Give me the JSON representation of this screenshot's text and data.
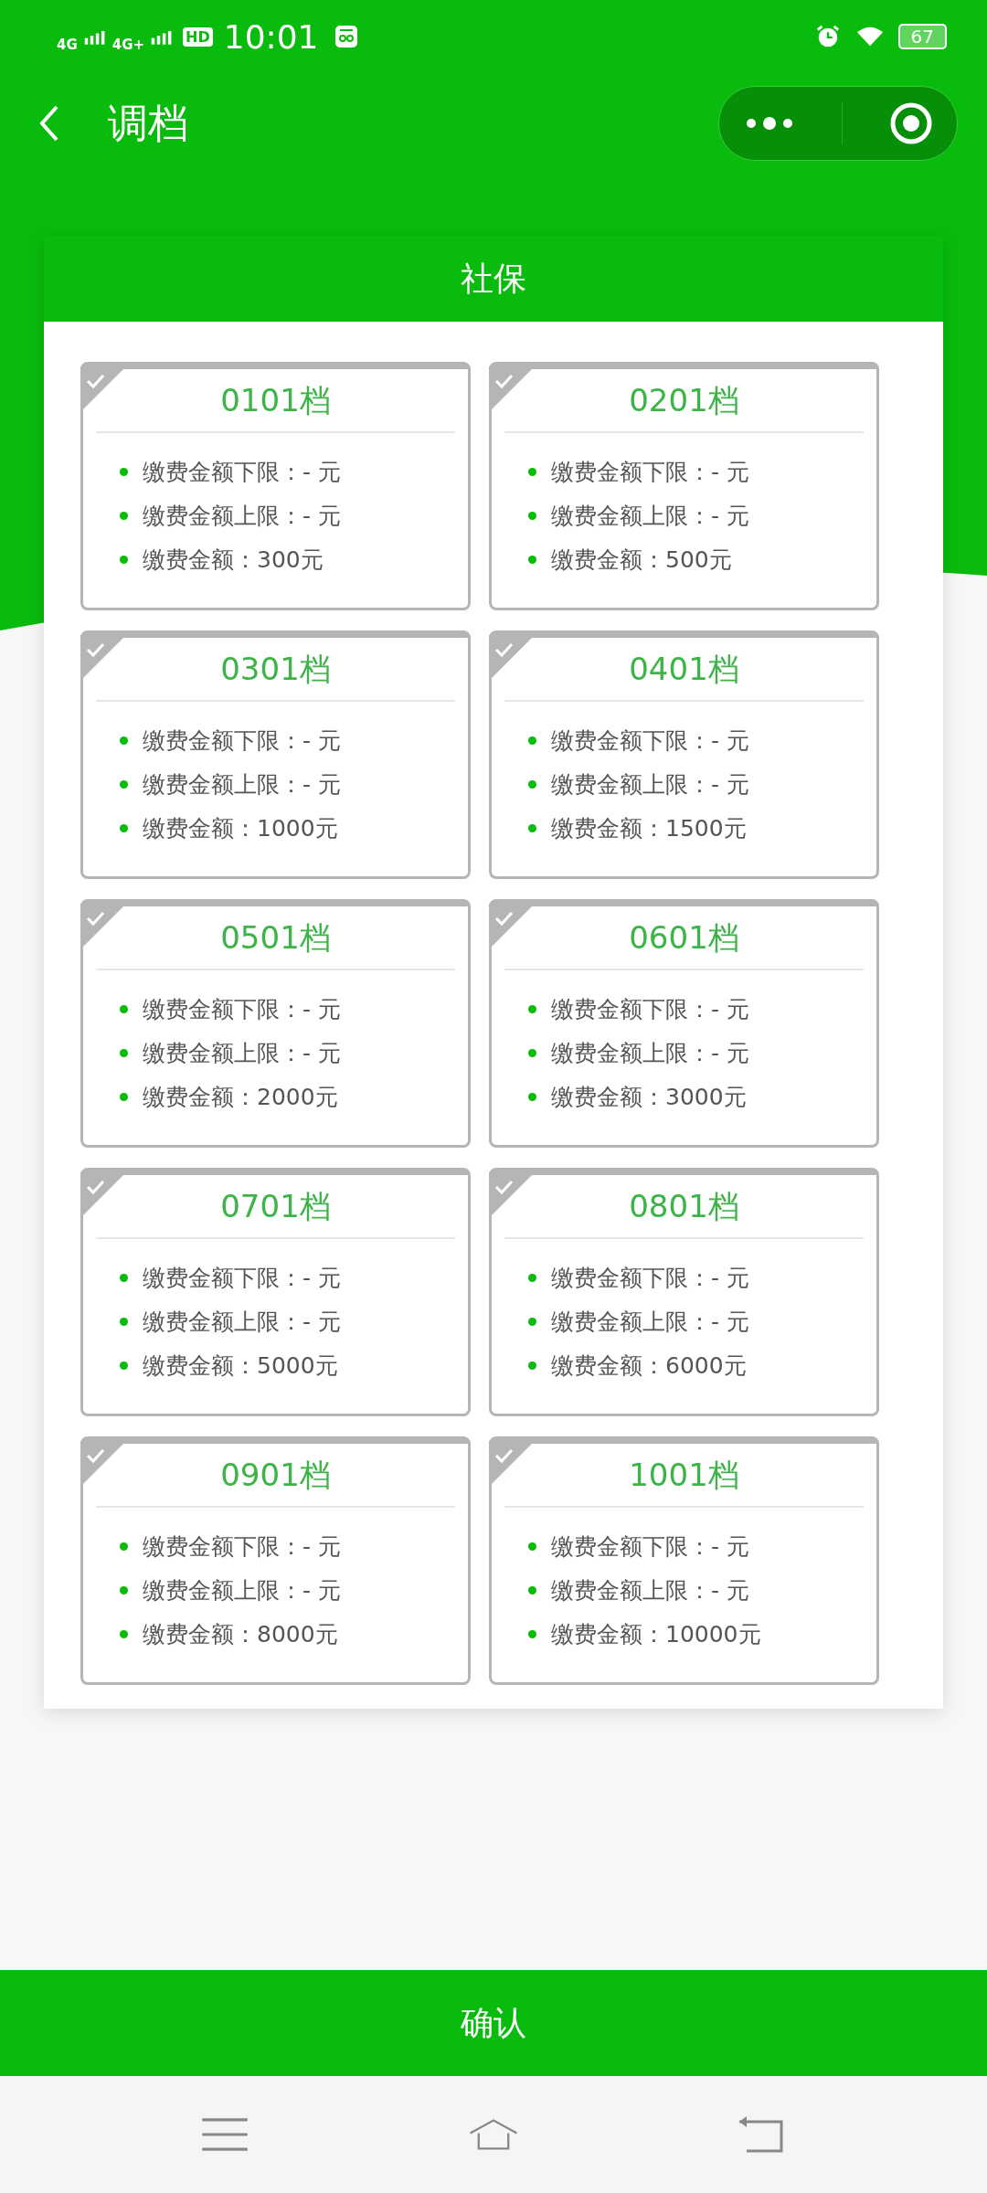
{
  "status_bar": {
    "network_1": "4G",
    "network_2": "4G+",
    "hd": "HD",
    "time": "10:01",
    "battery": "67"
  },
  "header": {
    "title": "调档"
  },
  "panel": {
    "title": "社保",
    "tiers": [
      {
        "name": "0101档",
        "selected": false,
        "lines": [
          "缴费金额下限：- 元",
          "缴费金额上限：- 元",
          "缴费金额：300元"
        ]
      },
      {
        "name": "0201档",
        "selected": false,
        "lines": [
          "缴费金额下限：- 元",
          "缴费金额上限：- 元",
          "缴费金额：500元"
        ]
      },
      {
        "name": "0301档",
        "selected": false,
        "lines": [
          "缴费金额下限：- 元",
          "缴费金额上限：- 元",
          "缴费金额：1000元"
        ]
      },
      {
        "name": "0401档",
        "selected": false,
        "lines": [
          "缴费金额下限：- 元",
          "缴费金额上限：- 元",
          "缴费金额：1500元"
        ]
      },
      {
        "name": "0501档",
        "selected": false,
        "lines": [
          "缴费金额下限：- 元",
          "缴费金额上限：- 元",
          "缴费金额：2000元"
        ]
      },
      {
        "name": "0601档",
        "selected": false,
        "lines": [
          "缴费金额下限：- 元",
          "缴费金额上限：- 元",
          "缴费金额：3000元"
        ]
      },
      {
        "name": "0701档",
        "selected": false,
        "lines": [
          "缴费金额下限：- 元",
          "缴费金额上限：- 元",
          "缴费金额：5000元"
        ]
      },
      {
        "name": "0801档",
        "selected": false,
        "lines": [
          "缴费金额下限：- 元",
          "缴费金额上限：- 元",
          "缴费金额：6000元"
        ]
      },
      {
        "name": "0901档",
        "selected": false,
        "lines": [
          "缴费金额下限：- 元",
          "缴费金额上限：- 元",
          "缴费金额：8000元"
        ]
      },
      {
        "name": "1001档",
        "selected": false,
        "lines": [
          "缴费金额下限：- 元",
          "缴费金额上限：- 元",
          "缴费金额：10000元"
        ]
      }
    ]
  },
  "confirm_button": "确认"
}
